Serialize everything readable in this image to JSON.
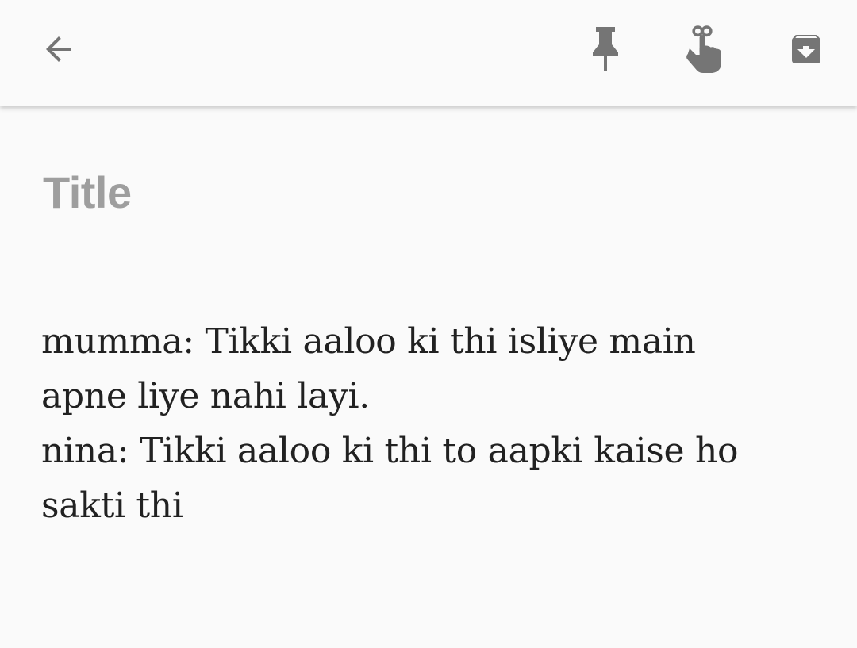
{
  "toolbar": {
    "back_icon": "arrow-left-icon",
    "pin_icon": "pin-icon",
    "reminder_icon": "reminder-finger-icon",
    "archive_icon": "archive-icon",
    "icon_color": "#757575"
  },
  "note": {
    "title_placeholder": "Title",
    "body_lines": [
      "mumma: Tikki aaloo ki thi isliye main",
      "apne liye nahi layi.",
      "nina: Tikki aaloo ki thi to aapki kaise ho",
      "sakti thi"
    ]
  },
  "colors": {
    "background": "#fafafa",
    "text": "#212121",
    "placeholder": "#9e9e9e"
  }
}
